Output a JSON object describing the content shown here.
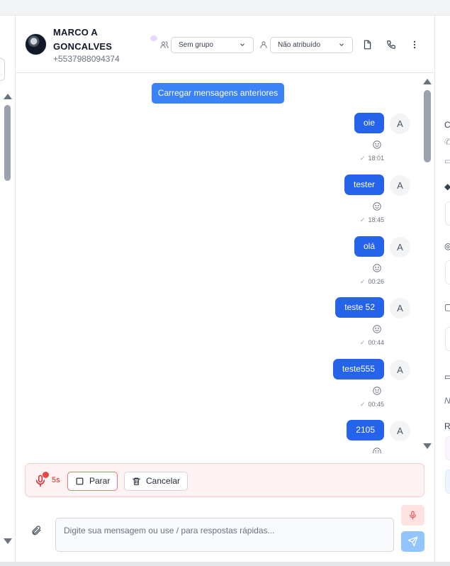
{
  "contact": {
    "name": "MARCO A GONCALVES",
    "phone": "+5537988094374"
  },
  "header": {
    "group_select": "Sem grupo",
    "assignee_select": "Não atribuído",
    "icons": [
      "users-icon",
      "user-icon",
      "document-icon",
      "phone-icon",
      "more-vertical-icon"
    ]
  },
  "messages_panel": {
    "load_more_label": "Carregar mensagens anteriores",
    "avatar_initial": "A",
    "messages": [
      {
        "text": "oie",
        "time": "18:01"
      },
      {
        "text": "tester",
        "time": "18:45"
      },
      {
        "text": "olá",
        "time": "00:26"
      },
      {
        "text": "teste 52",
        "time": "00:44"
      },
      {
        "text": "teste555",
        "time": "00:45"
      },
      {
        "text": "2105",
        "time": ""
      }
    ]
  },
  "recording": {
    "elapsed": "5s",
    "stop_label": "Parar",
    "cancel_label": "Cancelar",
    "accent_color": "#dc2626"
  },
  "composer": {
    "placeholder": "Digite sua mensagem ou use / para respostas rápidas..."
  },
  "colors": {
    "primary": "#2563eb",
    "load_button": "#3b82f6",
    "send_disabled": "#93c5fd"
  }
}
